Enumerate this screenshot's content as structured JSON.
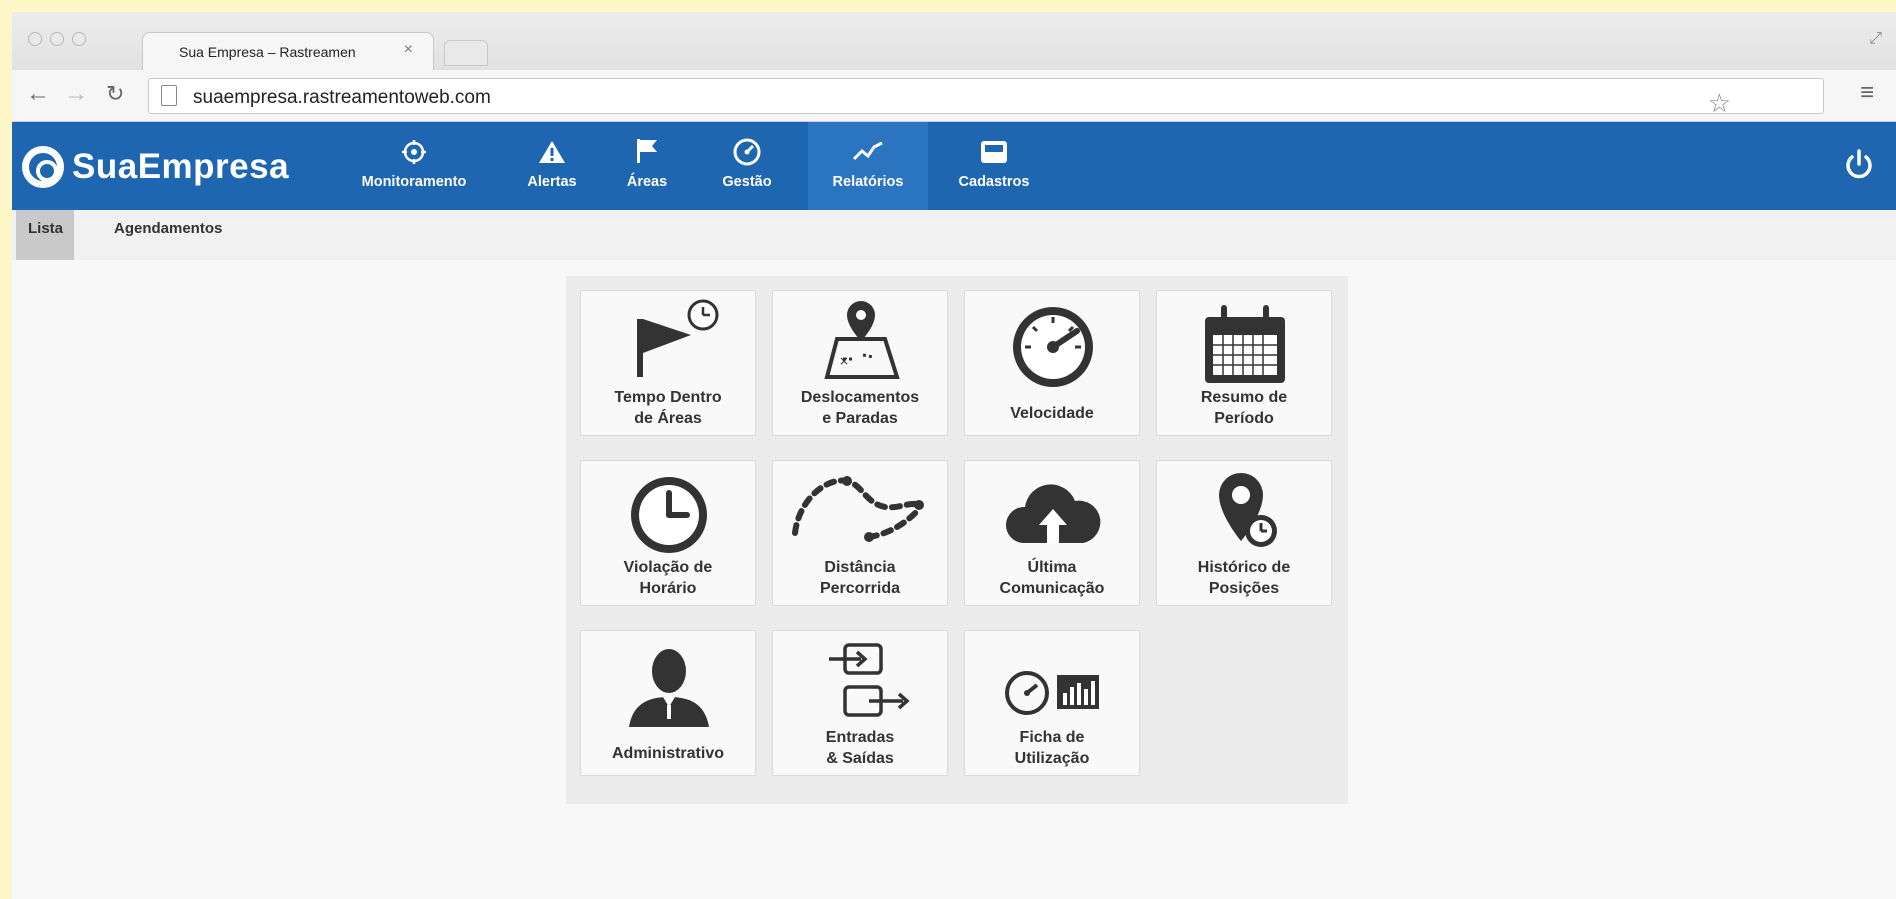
{
  "browser": {
    "tab_title": "Sua Empresa – Rastreamen",
    "tab_close": "×",
    "url": "suaempresa.rastreamentoweb.com"
  },
  "app": {
    "brand": "SuaEmpresa",
    "menu": [
      {
        "label": "Monitoramento",
        "icon": "crosshair-icon"
      },
      {
        "label": "Alertas",
        "icon": "warning-icon"
      },
      {
        "label": "Áreas",
        "icon": "flag-icon"
      },
      {
        "label": "Gestão",
        "icon": "gauge-icon"
      },
      {
        "label": "Relatórios",
        "icon": "chart-line-icon",
        "active": true
      },
      {
        "label": "Cadastros",
        "icon": "inbox-icon"
      }
    ],
    "primary_color": "#1f66b1"
  },
  "subnav": {
    "items": [
      {
        "label": "Lista",
        "active": true
      },
      {
        "label": "Agendamentos"
      }
    ]
  },
  "reports": [
    {
      "line1": "Tempo Dentro",
      "line2": "de Áreas",
      "icon": "flag-clock-icon"
    },
    {
      "line1": "Deslocamentos",
      "line2": "e Paradas",
      "icon": "map-pin-icon"
    },
    {
      "line1": "Velocidade",
      "line2": "",
      "icon": "speedometer-icon"
    },
    {
      "line1": "Resumo de",
      "line2": "Período",
      "icon": "calendar-icon"
    },
    {
      "line1": "Violação de",
      "line2": "Horário",
      "icon": "clock-icon"
    },
    {
      "line1": "Distância",
      "line2": "Percorrida",
      "icon": "route-icon"
    },
    {
      "line1": "Última",
      "line2": "Comunicação",
      "icon": "cloud-upload-icon"
    },
    {
      "line1": "Histórico de",
      "line2": "Posições",
      "icon": "location-history-icon"
    },
    {
      "line1": "Administrativo",
      "line2": "",
      "icon": "user-icon"
    },
    {
      "line1": "Entradas",
      "line2": "& Saídas",
      "icon": "enter-exit-icon"
    },
    {
      "line1": "Ficha de",
      "line2": "Utilização",
      "icon": "gauge-chart-icon"
    }
  ]
}
